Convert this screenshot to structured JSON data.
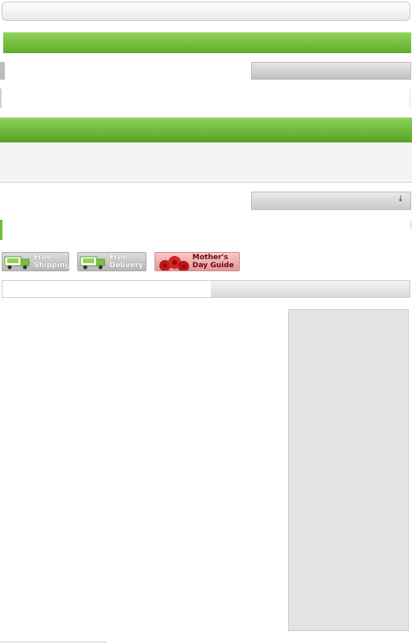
{
  "badges": {
    "free_shipping": "Free\nShipping",
    "free_delivery": "Free\nDelivery",
    "mothers_day": "Mother's\nDay Guide"
  },
  "sort": {
    "arrow": "↓"
  },
  "colors": {
    "green": "#6fbf3a",
    "panel_gray": "#e3e3e3",
    "badge_pink": "#e59a9a"
  },
  "icons": {
    "shipping": "truck-icon",
    "delivery": "truck-icon",
    "mothers_day": "rose-icon"
  }
}
